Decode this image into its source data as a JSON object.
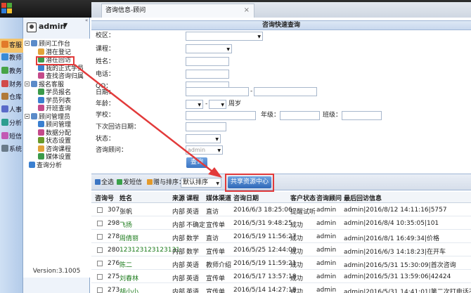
{
  "app": {
    "tab_title": "咨询信息-顾问",
    "tab_close": "×",
    "logo_colors": [
      "#e2452f",
      "#4caa3a",
      "#2d7bd8",
      "#f2c12e"
    ]
  },
  "user": {
    "name": "admin",
    "caret": "▼",
    "scroll_indicator": "«"
  },
  "left_nav": [
    {
      "label": "客服",
      "color": "#e27a2a",
      "active": true
    },
    {
      "label": "教师",
      "color": "#3a8bd6"
    },
    {
      "label": "教务",
      "color": "#47a447"
    },
    {
      "label": "财务",
      "color": "#d14a4a"
    },
    {
      "label": "仓库",
      "color": "#b07a3a"
    },
    {
      "label": "人事",
      "color": "#5a6bc9"
    },
    {
      "label": "分析",
      "color": "#2c9d8f"
    },
    {
      "label": "短信",
      "color": "#c25ab4"
    },
    {
      "label": "系统",
      "color": "#6a7b8a"
    }
  ],
  "tree": {
    "groups": [
      {
        "label": "顾问工作台",
        "items": [
          "潜在登记",
          "潜在回访",
          "我的正式学员",
          "查找咨询归属"
        ]
      },
      {
        "label": "报名客服",
        "items": [
          "学员报名",
          "学员列表",
          "开班查询"
        ]
      },
      {
        "label": "顾问管理员",
        "items": [
          "顾问管理",
          "数据分配",
          "状态设置",
          "咨询课程",
          "媒体设置"
        ]
      }
    ],
    "extra": "查询分析",
    "version": "Version:3.1005"
  },
  "search": {
    "title": "咨询快速查询",
    "labels": {
      "campus": "校区：",
      "course": "课程：",
      "name": "姓名：",
      "phone": "电话：",
      "qq": "QQ：",
      "date": "日期：",
      "age": "年龄：",
      "school": "学校：",
      "grade": "年级：",
      "class": "班级：",
      "next_date": "下次回访日期：",
      "status": "状态：",
      "advisor": "咨询顾问："
    },
    "age_unit": "周岁",
    "date_sep": "-",
    "age_sep": "-",
    "advisor_value": "admin",
    "query_button": "查询"
  },
  "toolbar": {
    "select_all": "全选",
    "send_sms": "发短信",
    "gift_sort": "赠与排序：",
    "sort_value": "默认排序",
    "share_button": "共享资源中心"
  },
  "table": {
    "headers": [
      "咨询号",
      "姓名",
      "来源",
      "课程",
      "媒体渠道",
      "咨询日期",
      "客户状态",
      "咨询顾问",
      "最后回访信息"
    ],
    "rows": [
      {
        "id": "307",
        "name": "张帆",
        "source": "内部",
        "course": "英语",
        "media": "直访",
        "date": "2016/6/3 18:25:06",
        "status": "提醒试听",
        "advisor": "admin",
        "last": "admin|2016/8/12 14:11:16|5757",
        "green": false
      },
      {
        "id": "298",
        "name": "飞扬",
        "source": "内部",
        "course": "不确定",
        "media": "宣传单",
        "date": "2016/5/31 9:48:25",
        "status": "成功",
        "advisor": "admin",
        "last": "admin|2016/8/4 10:35:05|101",
        "green": true
      },
      {
        "id": "278",
        "name": "周倩丽",
        "source": "内部",
        "course": "数学",
        "media": "直访",
        "date": "2016/5/19 11:56:27",
        "status": "成功",
        "advisor": "admin",
        "last": "admin|2016/8/1 16:49:34|价格",
        "green": true
      },
      {
        "id": "280",
        "name": "123123123123131",
        "source": "内部",
        "course": "数学",
        "media": "宣传单",
        "date": "2016/5/25 12:44:00",
        "status": "成功",
        "advisor": "admin",
        "last": "admin|2016/6/3 14:18:23|在开车",
        "green": true
      },
      {
        "id": "276",
        "name": "陈二",
        "source": "内部",
        "course": "英语",
        "media": "教师介绍",
        "date": "2016/5/19 11:59:21",
        "status": "成功",
        "advisor": "admin",
        "last": "admin|2016/5/31 15:30:09|首次咨询",
        "green": true
      },
      {
        "id": "275",
        "name": "刘春林",
        "source": "内部",
        "course": "英语",
        "media": "宣传单",
        "date": "2016/5/17 13:57:18",
        "status": "成功",
        "advisor": "admin",
        "last": "admin|2016/5/31 13:59:06|42424",
        "green": true
      },
      {
        "id": "273",
        "name": "胡小小",
        "source": "内部",
        "course": "英语",
        "media": "宣传单",
        "date": "2016/5/14 14:27:18",
        "status": "成功",
        "advisor": "admin",
        "last": "admin|2016/5/31 14:41:01|第二次打电话不...",
        "green": true
      }
    ]
  },
  "colors": {
    "highlight": "#e23a3a",
    "accent": "#3b75c3",
    "row_green": "#1a7a1a"
  }
}
